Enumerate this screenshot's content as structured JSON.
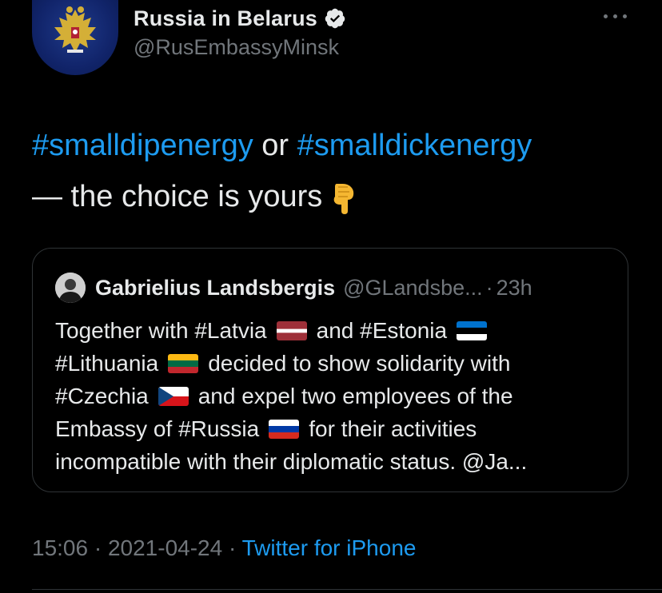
{
  "author": {
    "display_name": "Russia in Belarus",
    "handle": "@RusEmbassyMinsk",
    "verified": true,
    "avatar_icon": "russian-coat-of-arms"
  },
  "tweet": {
    "hashtag_1": "#smalldipenergy",
    "connector": " or ",
    "hashtag_2": "#smalldickenergy",
    "line_2": "— the choice is yours",
    "emoji_icon": "backhand-index-pointing-down"
  },
  "quoted_tweet": {
    "display_name": "Gabrielius Landsbergis",
    "handle": "@GLandsbe...",
    "separator": "·",
    "time": "23h",
    "text_segments": {
      "s1": "Together with ",
      "s2": "#Latvia",
      "s3": "and ",
      "s4": "#Estonia",
      "s5": "#Lithuania",
      "s6": "decided to show solidarity with",
      "s7": "#Czechia",
      "s8": "and expel two employees of the",
      "s9": "Embassy of ",
      "s10": "#Russia",
      "s11": "for their activities",
      "s12": "incompatible with their diplomatic status. @Ja..."
    },
    "flags": [
      "latvia-flag",
      "estonia-flag",
      "lithuania-flag",
      "czechia-flag",
      "russia-flag"
    ]
  },
  "meta": {
    "time": "15:06",
    "sep1": " · ",
    "date": "2021-04-24",
    "sep2": " · ",
    "source": "Twitter for iPhone"
  },
  "colors": {
    "background": "#000000",
    "text": "#e7e9ea",
    "secondary": "#71767b",
    "link": "#1d9bf0",
    "border": "#2f3336"
  }
}
